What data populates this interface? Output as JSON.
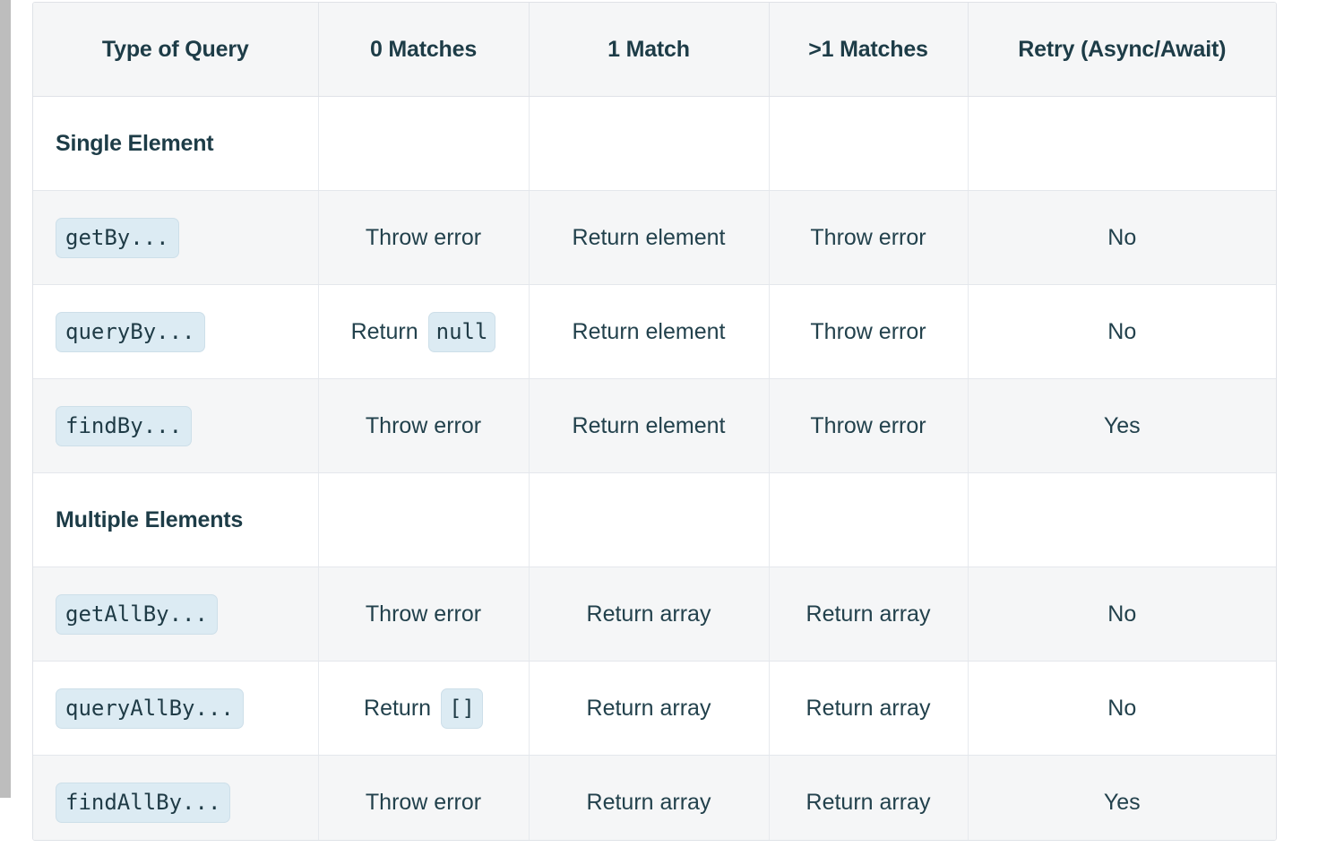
{
  "table": {
    "columns": [
      "Type of Query",
      "0 Matches",
      "1 Match",
      ">1 Matches",
      "Retry (Async/Await)"
    ],
    "rows": [
      {
        "kind": "section",
        "label": "Single Element",
        "zero_matches": "",
        "one_match": "",
        "many_matches": "",
        "retry": ""
      },
      {
        "kind": "query",
        "label": "getBy...",
        "zero_matches": "Throw error",
        "zero_matches_code": "",
        "one_match": "Return element",
        "many_matches": "Throw error",
        "retry": "No"
      },
      {
        "kind": "query",
        "label": "queryBy...",
        "zero_matches": "Return",
        "zero_matches_code": "null",
        "one_match": "Return element",
        "many_matches": "Throw error",
        "retry": "No"
      },
      {
        "kind": "query",
        "label": "findBy...",
        "zero_matches": "Throw error",
        "zero_matches_code": "",
        "one_match": "Return element",
        "many_matches": "Throw error",
        "retry": "Yes"
      },
      {
        "kind": "section",
        "label": "Multiple Elements",
        "zero_matches": "",
        "one_match": "",
        "many_matches": "",
        "retry": ""
      },
      {
        "kind": "query",
        "label": "getAllBy...",
        "zero_matches": "Throw error",
        "zero_matches_code": "",
        "one_match": "Return array",
        "many_matches": "Return array",
        "retry": "No"
      },
      {
        "kind": "query",
        "label": "queryAllBy...",
        "zero_matches": "Return",
        "zero_matches_code": "[]",
        "one_match": "Return array",
        "many_matches": "Return array",
        "retry": "No"
      },
      {
        "kind": "query",
        "label": "findAllBy...",
        "zero_matches": "Throw error",
        "zero_matches_code": "",
        "one_match": "Return array",
        "many_matches": "Return array",
        "retry": "Yes"
      }
    ]
  },
  "colors": {
    "header_text": "#1d3c47",
    "body_text": "#22414c",
    "header_bg": "#f5f6f7",
    "stripe_bg": "#f5f6f7",
    "code_chip_bg": "#dcebf3",
    "code_chip_border": "#cddfe9",
    "border": "#e2e5ea",
    "scrollbar_thumb": "#bdbdbd"
  }
}
